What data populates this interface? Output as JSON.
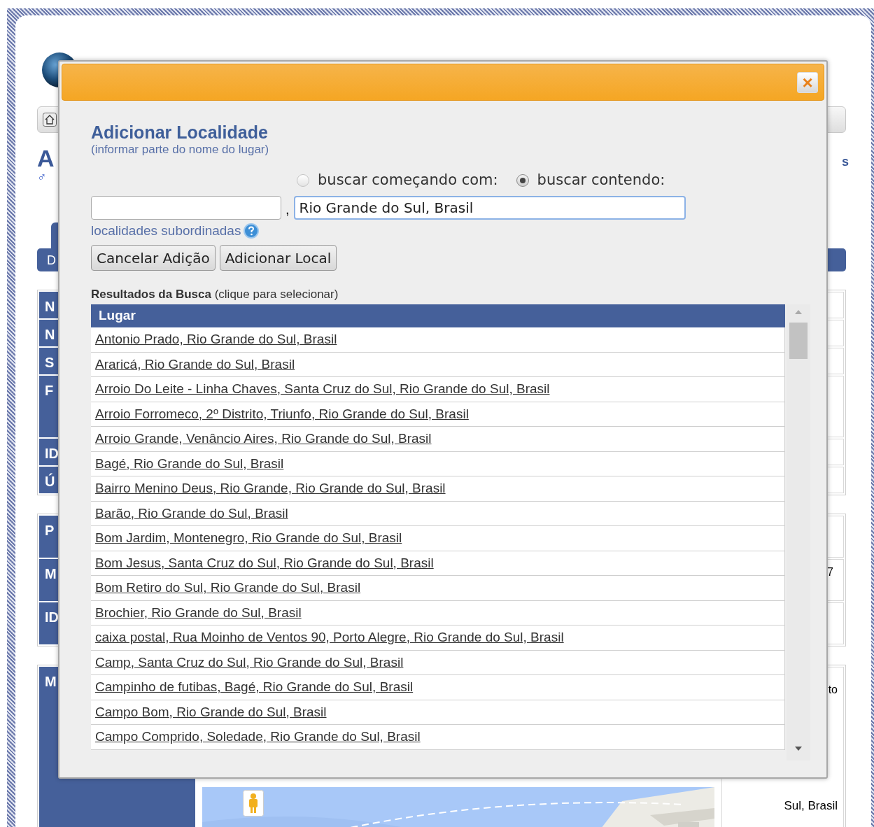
{
  "page": {
    "heading_fragment": "A",
    "gender_symbol": "♂",
    "right_fragment": "s",
    "tab_fragment": "D",
    "table_1": [
      "N",
      "N",
      "S",
      "F",
      "ID",
      "Ú"
    ],
    "table_2": [
      "P",
      "M",
      "ID"
    ],
    "table_2_right_fragment": "7",
    "table_3_label": "M",
    "table_3_right_top": "to",
    "table_3_right_bottom": "Sul, Brasil"
  },
  "dialog": {
    "close": "×",
    "title": "Adicionar Localidade",
    "subtitle": "(informar parte do nome do lugar)",
    "search_modes": [
      {
        "label": "buscar começando com:",
        "selected": false
      },
      {
        "label": "buscar contendo:",
        "selected": true
      }
    ],
    "separator": ",",
    "place_value": "Rio Grande do Sul, Brasil",
    "sub_link": "localidades subordinadas",
    "buttons": [
      "Cancelar Adição",
      "Adicionar Local"
    ],
    "results_caption": "**Resultados da Busca** (clique para selecionar)",
    "column": "Lugar",
    "rows": [
      "Antonio Prado, Rio Grande do Sul, Brasil",
      "Araricá, Rio Grande do Sul, Brasil",
      "Arroio Do Leite - Linha Chaves, Santa Cruz do Sul, Rio Grande do Sul, Brasil",
      "Arroio Forromeco, 2º Distrito, Triunfo, Rio Grande do Sul, Brasil",
      "Arroio Grande, Venâncio Aires, Rio Grande do Sul, Brasil",
      "Bagé, Rio Grande do Sul, Brasil",
      "Bairro Menino Deus, Rio Grande, Rio Grande do Sul, Brasil",
      "Barão, Rio Grande do Sul, Brasil",
      "Bom Jardim, Montenegro, Rio Grande do Sul, Brasil",
      "Bom Jesus, Santa Cruz do Sul, Rio Grande do Sul, Brasil",
      "Bom Retiro do Sul, Rio Grande do Sul, Brasil",
      "Brochier, Rio Grande do Sul, Brasil",
      "caixa postal, Rua Moinho de Ventos 90, Porto Alegre, Rio Grande do Sul, Brasil",
      "Camp, Santa Cruz do Sul, Rio Grande do Sul, Brasil",
      "Campinho de futibas, Bagé, Rio Grande do Sul, Brasil",
      "Campo Bom, Rio Grande do Sul, Brasil",
      "Campo Comprido, Soledade, Rio Grande do Sul, Brasil"
    ]
  }
}
